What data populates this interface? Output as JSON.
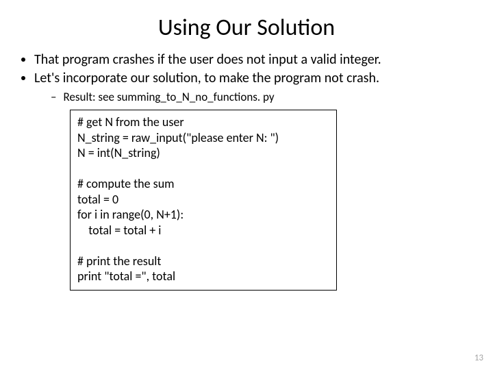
{
  "title": "Using Our Solution",
  "bullets": {
    "b1": "That program crashes if the user does not input a valid integer.",
    "b2": "Let's incorporate our solution, to make the program not crash.",
    "sub1": "Result: see summing_to_N_no_functions. py"
  },
  "code": "# get N from the user\nN_string = raw_input(\"please enter N: \")\nN = int(N_string)\n\n# compute the sum\ntotal = 0\nfor i in range(0, N+1):\n    total = total + i\n\n# print the result\nprint \"total =\", total",
  "page_number": "13"
}
